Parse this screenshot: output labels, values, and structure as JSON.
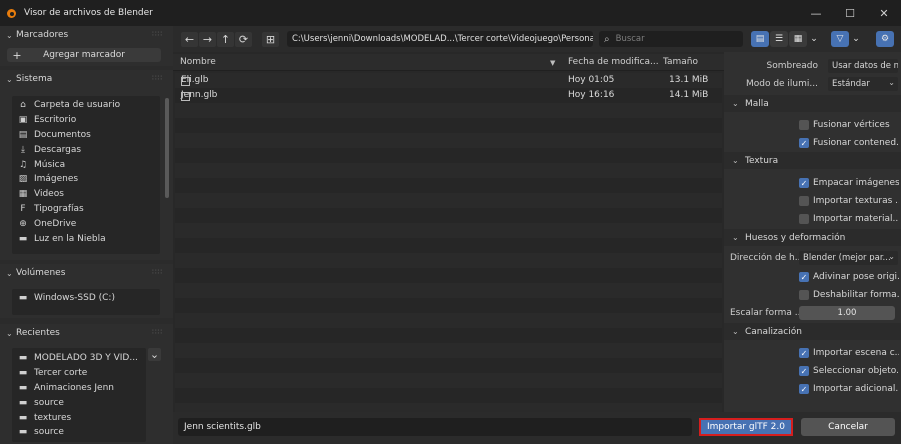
{
  "window": {
    "title": "Visor de archivos de Blender",
    "controls": [
      "—",
      "☐",
      "✕"
    ]
  },
  "sidebar": {
    "bookmarks": {
      "title": "Marcadores",
      "add_label": "Agregar marcador"
    },
    "system": {
      "title": "Sistema",
      "items": [
        {
          "label": "Carpeta de usuario",
          "icon": "home-icon",
          "glyph": "⌂"
        },
        {
          "label": "Escritorio",
          "icon": "desktop-icon",
          "glyph": "▣"
        },
        {
          "label": "Documentos",
          "icon": "documents-icon",
          "glyph": "▤"
        },
        {
          "label": "Descargas",
          "icon": "download-icon",
          "glyph": "⤓"
        },
        {
          "label": "Música",
          "icon": "music-icon",
          "glyph": "♫"
        },
        {
          "label": "Imágenes",
          "icon": "image-icon",
          "glyph": "▨"
        },
        {
          "label": "Videos",
          "icon": "video-icon",
          "glyph": "▦"
        },
        {
          "label": "Tipografías",
          "icon": "font-icon",
          "glyph": "F"
        },
        {
          "label": "OneDrive",
          "icon": "globe-icon",
          "glyph": "⊕"
        },
        {
          "label": "Luz en la Niebla",
          "icon": "folder-icon",
          "glyph": "▬"
        }
      ]
    },
    "volumes": {
      "title": "Volúmenes",
      "items": [
        {
          "label": "Windows-SSD (C:)",
          "icon": "disk-icon",
          "glyph": "▬"
        }
      ]
    },
    "recent": {
      "title": "Recientes",
      "items": [
        {
          "label": "MODELADO 3D Y VID...",
          "icon": "folder-icon",
          "glyph": "▬"
        },
        {
          "label": "Tercer corte",
          "icon": "folder-icon",
          "glyph": "▬"
        },
        {
          "label": "Animaciones Jenn",
          "icon": "folder-icon",
          "glyph": "▬"
        },
        {
          "label": "source",
          "icon": "folder-icon",
          "glyph": "▬"
        },
        {
          "label": "textures",
          "icon": "folder-icon",
          "glyph": "▬"
        },
        {
          "label": "source",
          "icon": "folder-icon",
          "glyph": "▬"
        }
      ]
    }
  },
  "toolbar": {
    "back": "←",
    "forward": "→",
    "parent": "↑",
    "refresh": "⟳",
    "new_folder": "⊞",
    "path": "C:\\Users\\jenni\\Downloads\\MODELAD...\\Tercer corte\\Videojuego\\Personajes\\",
    "search_placeholder": "Buscar",
    "search_glyph": "⌕",
    "filter_glyph": "▽",
    "settings_glyph": "⚙",
    "dropdown_glyph": "⌄"
  },
  "file_list": {
    "columns": {
      "name": "Nombre",
      "date": "Fecha de modifica...",
      "size": "Tamaño"
    },
    "sort_glyph": "▼",
    "rows": [
      {
        "name": "Eli.glb",
        "date": "Hoy 01:05",
        "size": "13.1 MiB"
      },
      {
        "name": "Jenn.glb",
        "date": "Hoy 16:16",
        "size": "14.1 MiB"
      }
    ]
  },
  "options": {
    "shading": {
      "label": "Sombreado",
      "value": "Usar datos de nor..."
    },
    "lighting": {
      "label": "Modo de ilumi...",
      "value": "Estándar"
    },
    "mesh": {
      "title": "Malla",
      "merge_vertices": {
        "label": "Fusionar vértices",
        "checked": false
      },
      "merge_content": {
        "label": "Fusionar contened...",
        "checked": true
      }
    },
    "texture": {
      "title": "Textura",
      "pack_images": {
        "label": "Empacar imágenes",
        "checked": true
      },
      "import_textures": {
        "label": "Importar texturas ...",
        "checked": false
      },
      "import_material": {
        "label": "Importar material...",
        "checked": false
      }
    },
    "bones": {
      "title": "Huesos y deformación",
      "bone_dir": {
        "label": "Dirección de h...",
        "value": "Blender (mejor par..."
      },
      "guess_pose": {
        "label": "Adivinar pose origi...",
        "checked": true
      },
      "disable_form": {
        "label": "Deshabilitar forma...",
        "checked": false
      },
      "scale_shape": {
        "label": "Escalar forma ...",
        "value": "1.00"
      }
    },
    "pipeline": {
      "title": "Canalización",
      "import_scene": {
        "label": "Importar escena c...",
        "checked": true
      },
      "select_objects": {
        "label": "Seleccionar objeto...",
        "checked": true
      },
      "import_extra": {
        "label": "Importar adicional...",
        "checked": true
      }
    }
  },
  "bottom": {
    "filename": "Jenn scientits.glb",
    "import_label": "Importar glTF 2.0",
    "cancel_label": "Cancelar"
  },
  "colors": {
    "accent": "#4772b3",
    "highlight_border": "#d51e1e",
    "logo": "#e87d0d"
  }
}
